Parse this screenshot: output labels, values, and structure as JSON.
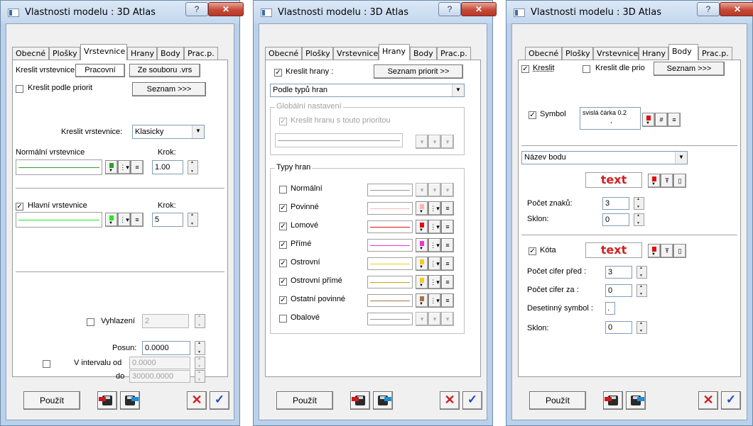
{
  "window_title": "Vlastnosti modelu : 3D Atlas",
  "help_glyph": "?",
  "close_glyph": "✕",
  "tabs": [
    "Obecné",
    "Plošky",
    "Vrstevnice",
    "Hrany",
    "Body",
    "Prac.p."
  ],
  "footer": {
    "apply_label": "Použít",
    "cancel_glyph": "✕",
    "ok_glyph": "✓"
  },
  "colors": {
    "green": "#2ca02c",
    "light_green": "#21e821",
    "pink": "#f7b7b7",
    "red": "#e01010",
    "magenta": "#f02fd7",
    "yellow": "#f4cc22",
    "gold": "#c9a21a",
    "brown": "#a5754a",
    "accent_red": "#d12020"
  },
  "icons": [
    "help-icon",
    "close-icon",
    "floppy-load-icon",
    "floppy-save-icon",
    "cancel-x-icon",
    "ok-check-icon",
    "dropdown-arrow-icon",
    "spin-icon",
    "grid-icon",
    "font-icon",
    "align-icon"
  ],
  "w1": {
    "kreslit_label": "Kreslit vrstevnice:",
    "pracovni_btn": "Pracovní",
    "ze_souboru_btn": "Ze souboru .vrs",
    "priorit_label": "Kreslit podle priorit",
    "seznam_btn": "Seznam >>>",
    "kreslit2_label": "Kreslit vrstevnice:",
    "kreslit2_value": "Klasicky",
    "normal_label": "Normální vrstevnice",
    "krok_label": "Krok:",
    "normal_krok": "1.00",
    "hlavni_label": "Hlavní vrstevnice",
    "krok2_label": "Krok:",
    "hlavni_krok": "5",
    "vyhlazeni_label": "Vyhlazení",
    "vyhlazeni_value": "2",
    "posun_label": "Posun:",
    "posun_value": "0.0000",
    "interval_label": "V intervalu od",
    "od_value": "0.0000",
    "do_label": "do",
    "do_value": "30000.0000"
  },
  "w2": {
    "kreslit_label": "Kreslit hrany :",
    "seznam_btn": "Seznam priorit >>",
    "combo_value": "Podle typů hran",
    "global_title": "Globální nastavení",
    "global_chk_label": "Kreslit hranu s touto prioritou",
    "types_title": "Typy hran",
    "types": [
      {
        "label": "Normální",
        "checked": false
      },
      {
        "label": "Povinné",
        "checked": true
      },
      {
        "label": "Lomové",
        "checked": true
      },
      {
        "label": "Přímé",
        "checked": true
      },
      {
        "label": "Ostrovní",
        "checked": true
      },
      {
        "label": "Ostrovní přímé",
        "checked": true
      },
      {
        "label": "Ostatní povinné",
        "checked": true
      },
      {
        "label": "Obalové",
        "checked": false
      }
    ]
  },
  "w3": {
    "kreslit_label": "Kreslit",
    "kreslit_prio_label": "Kreslit dle prio",
    "seznam_btn": "Seznam >>>",
    "symbol_label": "Symbol",
    "symbol_text": "svislá čárka 0.2",
    "symbol_dot": ",",
    "combo_value": "Název bodu",
    "text_sample": "text",
    "pocet_znaku_label": "Počet znaků:",
    "pocet_znaku": "3",
    "sklon_label": "Sklon:",
    "sklon_value": "0",
    "kota_label": "Kóta",
    "kota_text": "text",
    "cifer_pred_label": "Počet cifer před :",
    "cifer_pred": "3",
    "cifer_za_label": "Počet cifer za :",
    "cifer_za": "0",
    "desetinny_label": "Desetinný symbol :",
    "desetinny_value": ".",
    "sklon2_label": "Sklon:",
    "sklon2_value": "0"
  }
}
